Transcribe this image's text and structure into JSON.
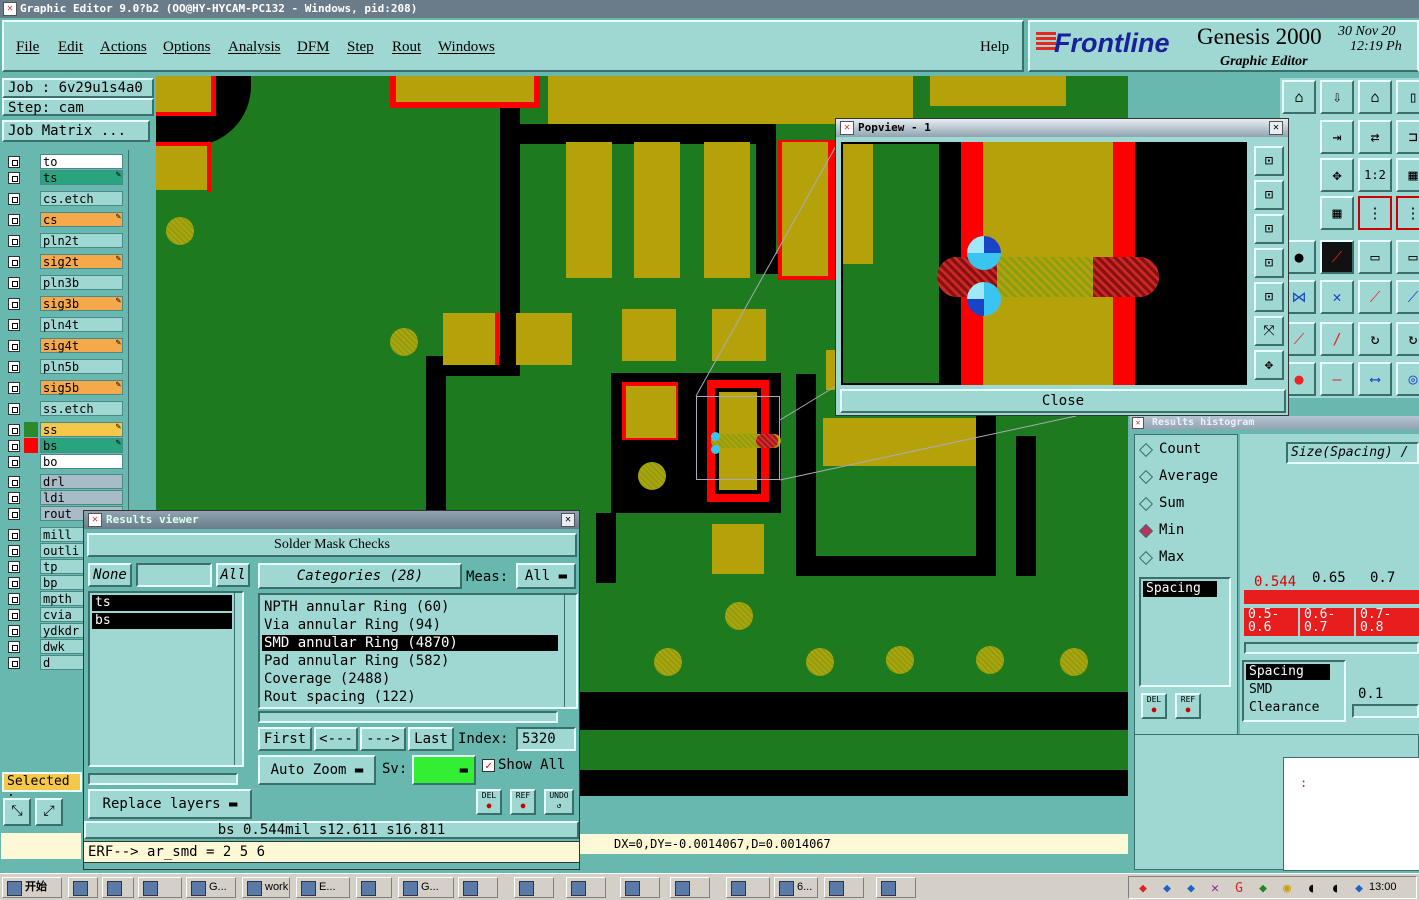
{
  "window": {
    "title": "Graphic Editor 9.0?b2 (OO@HY-HYCAM-PC132 - Windows, pid:208)"
  },
  "menu": {
    "file": "File",
    "edit": "Edit",
    "actions": "Actions",
    "options": "Options",
    "analysis": "Analysis",
    "dfm": "DFM",
    "step": "Step",
    "rout": "Rout",
    "windows": "Windows",
    "help": "Help"
  },
  "brand": {
    "logo": "Frontline",
    "product": "Genesis 2000",
    "subtitle": "Graphic Editor",
    "date": "30 Nov 20",
    "time": "12:19 Ph"
  },
  "job": {
    "job_label": "Job : 6v29u1s4a0",
    "step_label": "Step: cam",
    "matrix_button": "Job Matrix ..."
  },
  "layers": [
    {
      "name": "to",
      "color": "#ffffff",
      "swatch": "#68b8b0",
      "edit": ""
    },
    {
      "name": "ts",
      "color": "#2aa37f",
      "swatch": "#68b8b0",
      "edit": "✎"
    },
    {
      "name": "cs.etch",
      "color": "#9fd7d3",
      "swatch": "#68b8b0",
      "edit": ""
    },
    {
      "name": "cs",
      "color": "#f5a94a",
      "swatch": "#68b8b0",
      "edit": "✎"
    },
    {
      "name": "pln2t",
      "color": "#9fd7d3",
      "swatch": "#68b8b0",
      "edit": ""
    },
    {
      "name": "sig2t",
      "color": "#f5a94a",
      "swatch": "#68b8b0",
      "edit": "✎"
    },
    {
      "name": "pln3b",
      "color": "#9fd7d3",
      "swatch": "#68b8b0",
      "edit": ""
    },
    {
      "name": "sig3b",
      "color": "#f5a94a",
      "swatch": "#68b8b0",
      "edit": "✎"
    },
    {
      "name": "pln4t",
      "color": "#9fd7d3",
      "swatch": "#68b8b0",
      "edit": ""
    },
    {
      "name": "sig4t",
      "color": "#f5a94a",
      "swatch": "#68b8b0",
      "edit": "✎"
    },
    {
      "name": "pln5b",
      "color": "#9fd7d3",
      "swatch": "#68b8b0",
      "edit": ""
    },
    {
      "name": "sig5b",
      "color": "#f5a94a",
      "swatch": "#68b8b0",
      "edit": "✎"
    },
    {
      "name": "ss.etch",
      "color": "#9fd7d3",
      "swatch": "#68b8b0",
      "edit": ""
    },
    {
      "name": "ss",
      "color": "#f5c84a",
      "swatch": "#2c8a2c",
      "edit": "✎"
    },
    {
      "name": "bs",
      "color": "#2aa37f",
      "swatch": "#ff0000",
      "edit": "✎"
    },
    {
      "name": "bo",
      "color": "#ffffff",
      "swatch": "#68b8b0",
      "edit": ""
    },
    {
      "name": "drl",
      "color": "#a8bcc8",
      "swatch": "#68b8b0",
      "edit": ""
    },
    {
      "name": "ldi",
      "color": "#a8bcc8",
      "swatch": "#68b8b0",
      "edit": ""
    },
    {
      "name": "rout",
      "color": "#a8bcc8",
      "swatch": "#68b8b0",
      "edit": ""
    },
    {
      "name": "mill",
      "color": "#9fd7d3",
      "swatch": "#68b8b0",
      "edit": ""
    },
    {
      "name": "outli",
      "color": "#9fd7d3",
      "swatch": "#68b8b0",
      "edit": ""
    },
    {
      "name": "tp",
      "color": "#9fd7d3",
      "swatch": "#68b8b0",
      "edit": ""
    },
    {
      "name": "bp",
      "color": "#9fd7d3",
      "swatch": "#68b8b0",
      "edit": ""
    },
    {
      "name": "mpth",
      "color": "#9fd7d3",
      "swatch": "#68b8b0",
      "edit": ""
    },
    {
      "name": "cvia",
      "color": "#9fd7d3",
      "swatch": "#68b8b0",
      "edit": ""
    },
    {
      "name": "ydkdr",
      "color": "#9fd7d3",
      "swatch": "#68b8b0",
      "edit": ""
    },
    {
      "name": "dwk",
      "color": "#9fd7d3",
      "swatch": "#68b8b0",
      "edit": ""
    },
    {
      "name": "d",
      "color": "#9fd7d3",
      "swatch": "#68b8b0",
      "edit": ""
    }
  ],
  "selected": {
    "label": "Selected :"
  },
  "popview": {
    "title": "Popview - 1",
    "close": "Close"
  },
  "results_viewer": {
    "title": "Results viewer",
    "heading": "Solder Mask Checks",
    "none": "None",
    "all": "All",
    "categories_label": "Categories (28)",
    "meas_label": "Meas:",
    "meas_value": "All",
    "layers": [
      "ts",
      "bs"
    ],
    "categories": [
      "NPTH annular Ring (60)",
      "Via annular Ring (94)",
      "SMD annular Ring (4870)",
      "Pad annular Ring (582)",
      "Coverage (2488)",
      "Rout spacing (122)"
    ],
    "selected_category": 2,
    "first": "First",
    "prev": "<---",
    "next": "--->",
    "last": "Last",
    "index_label": "Index:",
    "index_value": "5320",
    "auto_zoom": "Auto Zoom",
    "sv_label": "Sv:",
    "show_all": "Show All",
    "replace_layers": "Replace layers",
    "del": "DEL",
    "ref": "REF",
    "undo": "UNDO",
    "status": "bs 0.544mil   s12.611  s16.811"
  },
  "histogram": {
    "title": "Results histogram",
    "options": [
      "Count",
      "Average",
      "Sum",
      "Min",
      "Max"
    ],
    "selected_option": 3,
    "size_label": "Size(Spacing) /",
    "list_item": "Spacing",
    "values": [
      "0.544",
      "0.65",
      "0.7"
    ],
    "ranges": [
      "0.5-\n0.6",
      "0.6-\n0.7",
      "0.7-\n0.8"
    ],
    "del": "DEL",
    "ref": "REF",
    "types": [
      "Spacing",
      "SMD",
      "Clearance"
    ],
    "type_value": "0.1"
  },
  "command_line": "ERF--> ar_smd = 2 5 6",
  "coords": "DX=0,DY=-0.0014067,D=0.0014067",
  "taskbar": {
    "start": "开始",
    "tasks": [
      "",
      "",
      "",
      "G...",
      "work",
      "E...",
      "",
      "G...",
      "",
      "",
      "",
      "",
      "",
      "",
      "6...",
      "",
      ""
    ],
    "clock": "13:00"
  },
  "colors": {
    "board_green": "#1e7a1e",
    "copper": "#b5a20a",
    "mask_red": "#ff0000",
    "panel": "#9fd7d3",
    "bg": "#68b8b0"
  }
}
